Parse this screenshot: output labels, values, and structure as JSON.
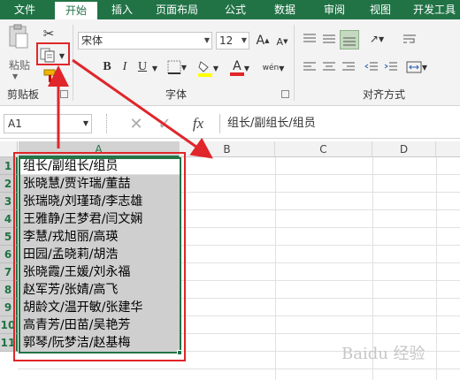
{
  "ribbon_tabs": [
    "文件",
    "开始",
    "插入",
    "页面布局",
    "公式",
    "数据",
    "审阅",
    "视图",
    "开发工具"
  ],
  "active_tab": "开始",
  "clipboard": {
    "paste_label": "粘贴",
    "group_label": "剪贴板"
  },
  "font": {
    "name": "宋体",
    "size": "12",
    "group_label": "字体",
    "bold": "B",
    "italic": "I",
    "underline": "U",
    "grow": "A",
    "shrink": "A",
    "phonetic": "wén"
  },
  "alignment": {
    "group_label": "对齐方式"
  },
  "formula_bar": {
    "name_box": "A1",
    "cancel": "✕",
    "enter": "✓",
    "fx": "fx",
    "formula": "组长/副组长/组员"
  },
  "columns": [
    "A",
    "B",
    "C",
    "D"
  ],
  "rows": [
    "1",
    "2",
    "3",
    "4",
    "5",
    "6",
    "7",
    "8",
    "9",
    "10",
    "11"
  ],
  "cells": [
    "组长/副组长/组员",
    "张晓慧/贾许瑞/董喆",
    "张瑞晓/刘瑾琦/李志雄",
    "王雅静/王梦君/闫文娴",
    "李慧/戎旭丽/高瑛",
    "田园/孟晓莉/胡浩",
    "张晓霞/王媛/刘永福",
    "赵军芳/张婧/高飞",
    "胡龄文/温开敏/张建华",
    "高青芳/田苗/吴艳芳",
    "郭琴/阮梦洁/赵基梅"
  ],
  "colors": {
    "accent": "#217346",
    "annotation": "#e0262a"
  },
  "watermark": "Baidu 经验"
}
